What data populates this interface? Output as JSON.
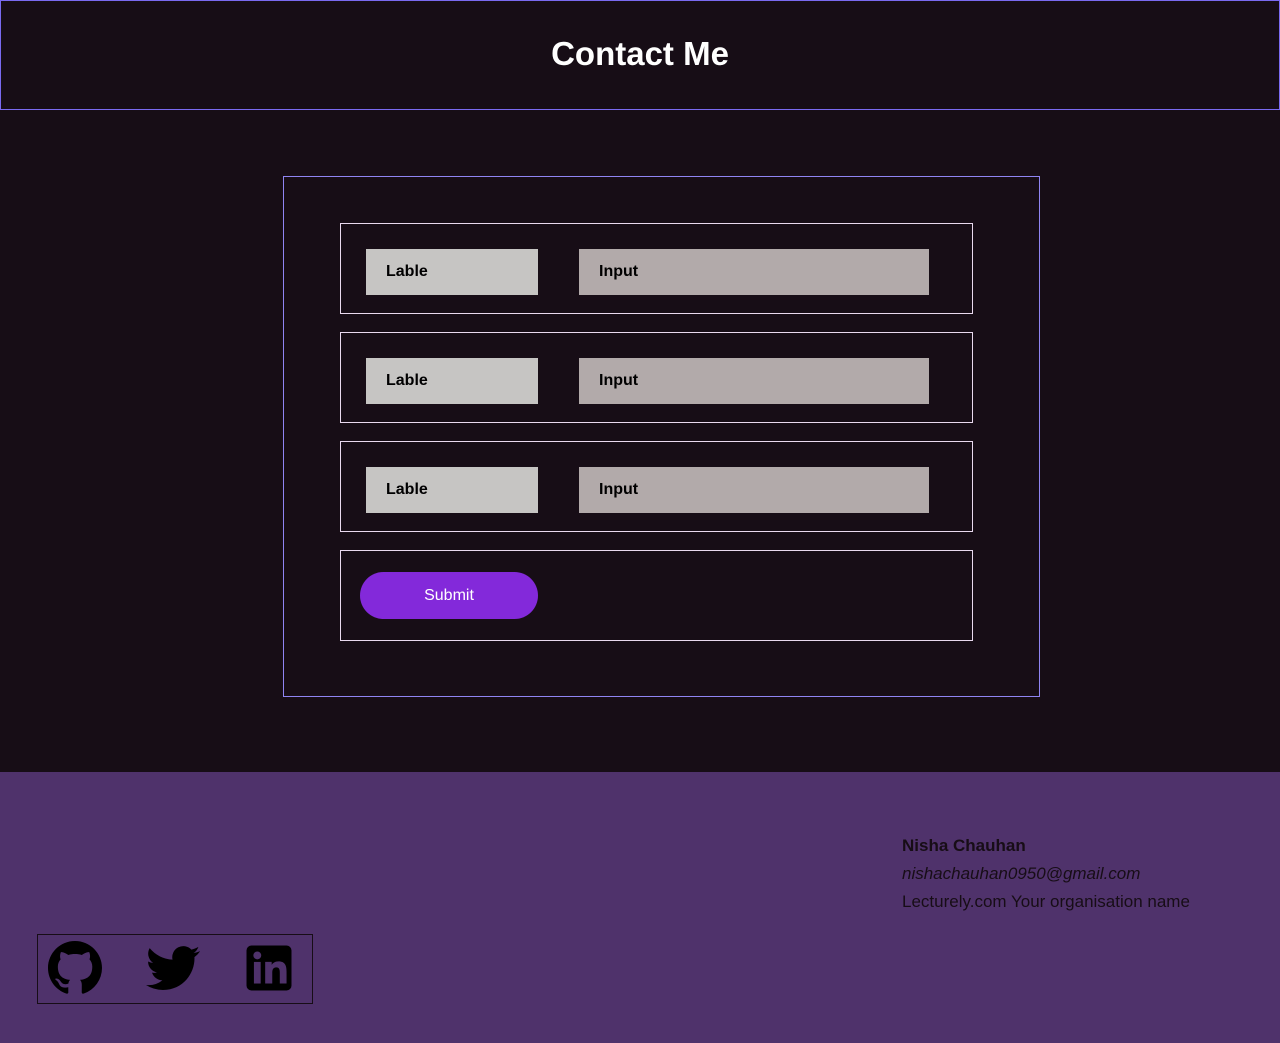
{
  "header": {
    "title": "Contact Me"
  },
  "form": {
    "rows": [
      {
        "label": "Lable",
        "input": "Input"
      },
      {
        "label": "Lable",
        "input": "Input"
      },
      {
        "label": "Lable",
        "input": "Input"
      }
    ],
    "submit_label": "Submit"
  },
  "footer": {
    "name": "Nisha Chauhan",
    "email": "nishachauhan0950@gmail.com",
    "organisation": "Lecturely.com Your organisation name",
    "social": [
      {
        "icon": "github-icon"
      },
      {
        "icon": "twitter-icon"
      },
      {
        "icon": "linkedin-icon"
      }
    ]
  },
  "colors": {
    "background": "#170d16",
    "header_border": "#7a6af0",
    "accent": "#8329da",
    "footer": "#4f326b",
    "label_bg": "#c6c5c3",
    "input_bg": "#b2aaaa"
  }
}
